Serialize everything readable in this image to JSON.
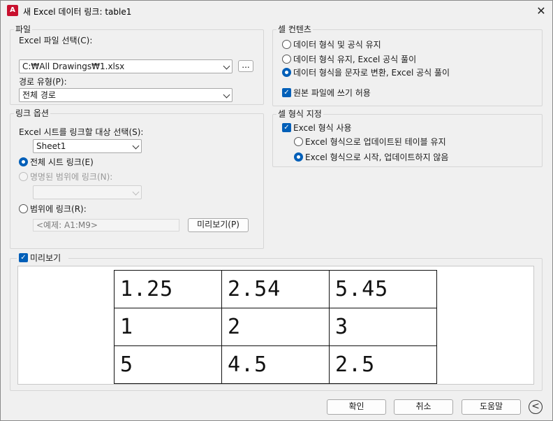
{
  "window": {
    "title": "새 Excel 데이터 링크: table1",
    "icon_text": "A"
  },
  "file_group": {
    "title": "파일",
    "select_label": "Excel 파일 선택(C):",
    "file_value": "C:₩All Drawings₩1.xlsx",
    "browse_label": "...",
    "path_type_label": "경로 유형(P):",
    "path_type_value": "전체 경로"
  },
  "link_options": {
    "title": "링크 옵션",
    "sheet_label": "Excel 시트를 링크할 대상 선택(S):",
    "sheet_value": "Sheet1",
    "entire_sheet_label": "전체 시트 링크(E)",
    "named_range_label": "명명된 범위에 링크(N):",
    "range_label": "범위에 링크(R):",
    "range_placeholder": "<예제: A1:M9>",
    "preview_button": "미리보기(P)"
  },
  "cell_contents": {
    "title": "셀 컨텐츠",
    "option1": "데이터 형식 및 공식 유지",
    "option2": "데이터 형식 유지, Excel 공식 풀이",
    "option3": "데이터 형식을 문자로 변환, Excel 공식 풀이",
    "allow_write": "원본 파일에 쓰기 허용"
  },
  "cell_format": {
    "title": "셀 형식 지정",
    "use_excel_format": "Excel 형식 사용",
    "keep_updated": "Excel 형식으로 업데이트된 테이블 유지",
    "start_no_update": "Excel 형식으로 시작, 업데이트하지 않음"
  },
  "preview": {
    "label": "미리보기",
    "rows": [
      [
        "1.25",
        "2.54",
        "5.45"
      ],
      [
        "1",
        "2",
        "3"
      ],
      [
        "5",
        "4.5",
        "2.5"
      ]
    ]
  },
  "footer": {
    "ok": "확인",
    "cancel": "취소",
    "help": "도움말",
    "expand_icon": "<"
  }
}
